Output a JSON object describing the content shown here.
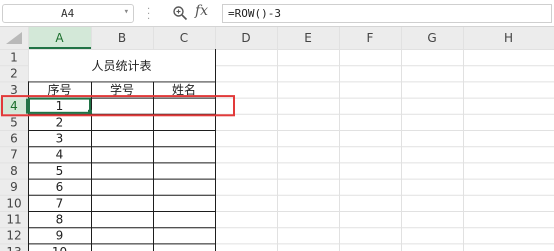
{
  "formula_bar": {
    "name_box": "A4",
    "fx_label": "fx",
    "formula": "=ROW()-3"
  },
  "columns": [
    "A",
    "B",
    "C",
    "D",
    "E",
    "F",
    "G",
    "H"
  ],
  "rows": [
    "1",
    "2",
    "3",
    "4",
    "5",
    "6",
    "7",
    "8",
    "9",
    "10",
    "11",
    "12",
    "13"
  ],
  "sheet": {
    "title": "人员统计表",
    "headers": [
      "序号",
      "学号",
      "姓名"
    ],
    "serials": [
      "1",
      "2",
      "3",
      "4",
      "5",
      "6",
      "7",
      "8",
      "9",
      "10"
    ]
  },
  "colors": {
    "header_bg": "#ececec",
    "active_header_bg": "#d3e8d8",
    "active_accent": "#217346",
    "highlight": "#e23a3a",
    "gridline": "#e1e1e1"
  }
}
